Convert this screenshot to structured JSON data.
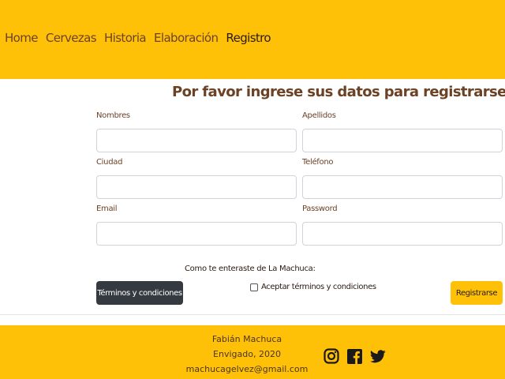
{
  "nav": {
    "items": [
      {
        "label": "Home"
      },
      {
        "label": "Cervezas"
      },
      {
        "label": "Historia"
      },
      {
        "label": "Elaboración"
      },
      {
        "label": "Registro"
      }
    ],
    "active": "Registro"
  },
  "form": {
    "title": "Por favor ingrese sus datos para registrarse:",
    "fields": {
      "nombres": {
        "label": "Nombres",
        "value": ""
      },
      "apellidos": {
        "label": "Apellidos",
        "value": ""
      },
      "ciudad": {
        "label": "Ciudad",
        "value": ""
      },
      "telefono": {
        "label": "Teléfono",
        "value": ""
      },
      "email": {
        "label": "Email",
        "value": ""
      },
      "password": {
        "label": "Password",
        "value": ""
      }
    },
    "source_label": "Como te enteraste de La Machuca:",
    "terms_button": "Términos y condiciones",
    "accept_terms": {
      "label": "Aceptar términos y condiciones",
      "checked": false
    },
    "submit_button": "Registrarse"
  },
  "footer": {
    "name": "Fabián Machuca",
    "location": "Envigado, 2020",
    "email": "machucagelvez@gmail.com",
    "social_icons": [
      "instagram-icon",
      "facebook-icon",
      "twitter-icon"
    ]
  },
  "colors": {
    "accent": "#ffc107",
    "text_brown": "#6b4226",
    "dark_button": "#343a40"
  }
}
